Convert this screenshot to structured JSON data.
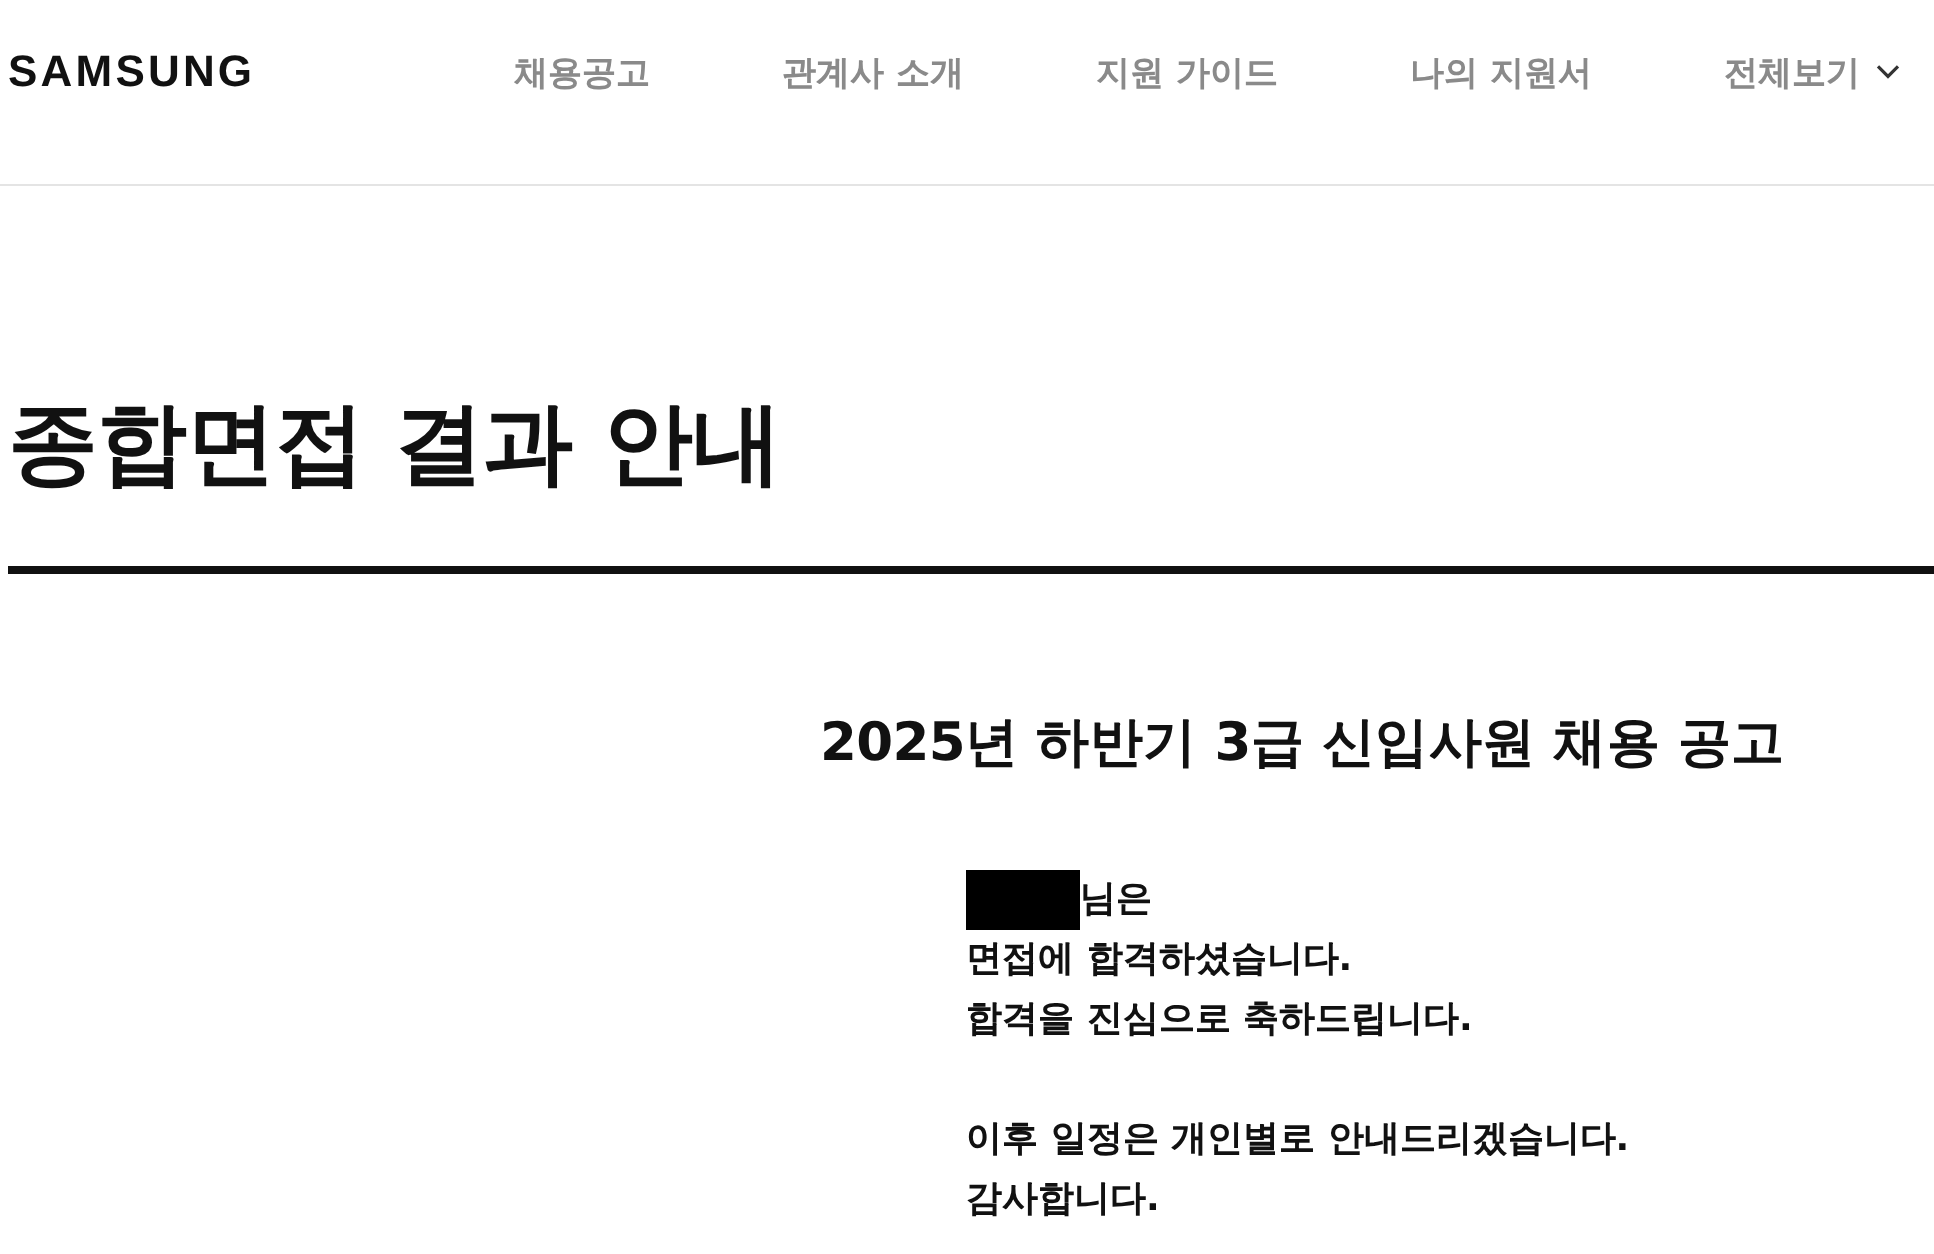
{
  "header": {
    "logo": "SAMSUNG",
    "nav": [
      {
        "label": "채용공고",
        "has_caret": false
      },
      {
        "label": "관계사 소개",
        "has_caret": false
      },
      {
        "label": "지원 가이드",
        "has_caret": false
      },
      {
        "label": "나의 지원서",
        "has_caret": false
      },
      {
        "label": "전체보기",
        "has_caret": true
      }
    ]
  },
  "page_title": "종합면접 결과 안내",
  "notice": {
    "heading": "2025년 하반기 3급 신입사원 채용 공고",
    "recipient": {
      "redacted": true,
      "suffix": "님은"
    },
    "paragraphs": [
      [
        "면접에 합격하셨습니다.",
        "합격을 진심으로 축하드립니다."
      ],
      [
        "이후 일정은 개인별로 안내드리겠습니다.",
        "감사합니다."
      ]
    ]
  }
}
